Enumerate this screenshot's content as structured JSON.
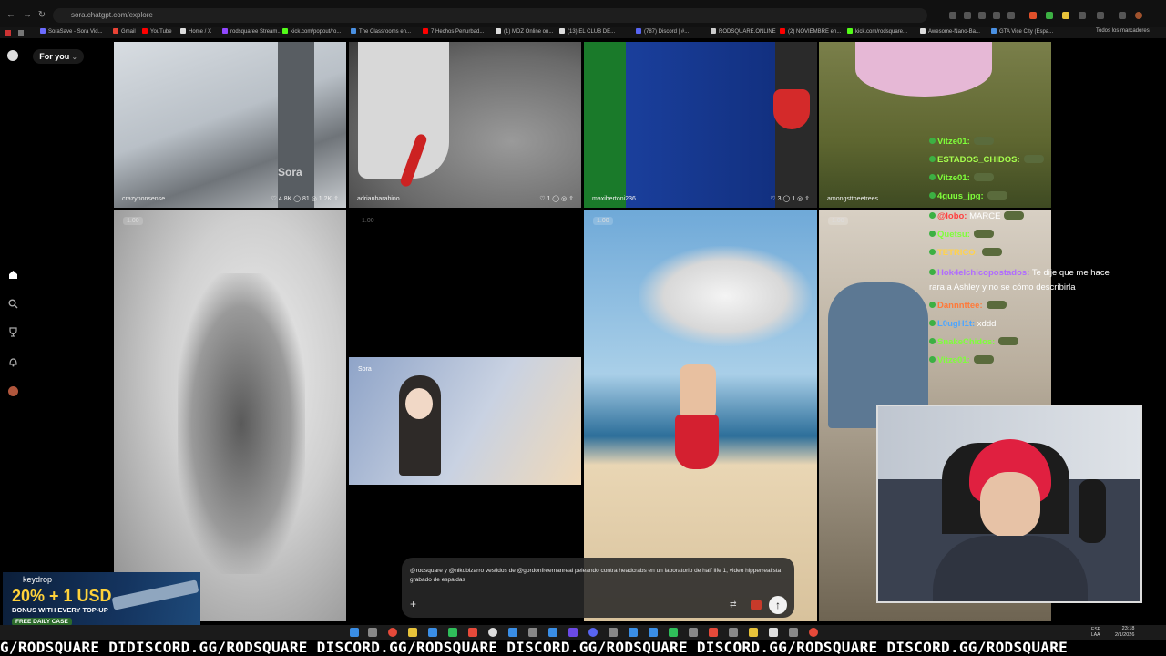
{
  "browser": {
    "url": "sora.chatgpt.com/explore",
    "bookmarks": [
      {
        "label": "SoraSave - Sora Vid...",
        "color": "#6b6bff"
      },
      {
        "label": "Gmail",
        "color": "#ea4335"
      },
      {
        "label": "YouTube",
        "color": "#ff0000"
      },
      {
        "label": "Home / X",
        "color": "#dddddd"
      },
      {
        "label": "rodsquaree Stream...",
        "color": "#9146ff"
      },
      {
        "label": "kick.com/popout/ro...",
        "color": "#53fc18"
      },
      {
        "label": "The Classrooms en...",
        "color": "#4a90e2"
      },
      {
        "label": "7 Hechos Perturbad...",
        "color": "#ff0000"
      },
      {
        "label": "(1) MDZ Online on...",
        "color": "#dddddd"
      },
      {
        "label": "(13) EL CLUB DE...",
        "color": "#dddddd"
      },
      {
        "label": "(787) Discord | #...",
        "color": "#5865f2"
      },
      {
        "label": "RODSQUARE.ONLINE",
        "color": "#cccccc"
      },
      {
        "label": "(2) NOVIEMBRE en...",
        "color": "#ff0000"
      },
      {
        "label": "kick.com/rodsquare...",
        "color": "#53fc18"
      },
      {
        "label": "Awesome-Nano-Ba...",
        "color": "#dddddd"
      },
      {
        "label": "GTA Vice City (Espa...",
        "color": "#4a90e2"
      }
    ],
    "all_bookmarks": "Todos los marcadores"
  },
  "sora": {
    "filter_label": "For you",
    "cards_top": [
      {
        "user": "crazynonsense",
        "stats": "♡ 4.8K  ◯ 81  ◎ 1.2K  ⇧",
        "watermark": "Sora"
      },
      {
        "user": "adrianbarabino",
        "stats": "♡ 1  ◯  ◎  ⇧"
      },
      {
        "user": "maxibertoni236",
        "stats": "♡ 3  ◯ 1  ◎  ⇧"
      },
      {
        "user": "amongsttheetrees",
        "stats": ""
      }
    ],
    "speed_chip": "1.00",
    "card_sora_label": "Sora",
    "prompt_text": "@rodsquare y @nikobizarro vestidos de @gordonfreemanreal peleando contra headcrabs en un laboratorio de half life 1, video hipperrealista grabado de espaldas",
    "prompt_add": "+"
  },
  "chat": [
    {
      "name": "Vitze01:",
      "color": "#7fff3a",
      "msg": "",
      "emote": true
    },
    {
      "name": "ESTADOS_CHIDOS:",
      "color": "#a6ff4d",
      "msg": "",
      "emote": true
    },
    {
      "name": "Vitze01:",
      "color": "#7fff3a",
      "msg": "",
      "emote": true
    },
    {
      "name": "4guus_jpg:",
      "color": "#7fff3a",
      "msg": "",
      "emote": true
    },
    {
      "name": "@lobo:",
      "color": "#ff4040",
      "msg": " MARCE",
      "emote": true
    },
    {
      "name": "Quetsu:",
      "color": "#7fff3a",
      "msg": "",
      "emote": true
    },
    {
      "name": "TETRICO:",
      "color": "#ffd24d",
      "msg": "",
      "emote": true
    },
    {
      "name": "Hok4elchicopostados:",
      "color": "#b06bff",
      "msg": " Te dije que me hace",
      "emote": false
    },
    {
      "name": "",
      "color": "#ffffff",
      "msg": "rara a Ashley y no se cómo describirla",
      "emote": false
    },
    {
      "name": "Dannnttee:",
      "color": "#ff7a3a",
      "msg": "",
      "emote": true
    },
    {
      "name": "L0ugH1t:",
      "color": "#4da6ff",
      "msg": " xddd",
      "emote": false
    },
    {
      "name": "SnakeChidos:",
      "color": "#7fff3a",
      "msg": "",
      "emote": true
    },
    {
      "name": "Vitze01:",
      "color": "#7fff3a",
      "msg": "",
      "emote": true
    }
  ],
  "ad": {
    "brand": "keydrop",
    "headline": "20% + 1 USD",
    "sub": "BONUS WITH EVERY TOP-UP",
    "cta": "FREE DAILY CASE"
  },
  "taskbar": {
    "lang": "ESP\nLAA",
    "time": "23:18",
    "date": "2/1/2026"
  },
  "ticker": "G/RODSQUARE DIDISCORD.GG/RODSQUARE DISCORD.GG/RODSQUARE DISCORD.GG/RODSQUARE DISCORD.GG/RODSQUARE DISCORD.GG/RODSQUARE"
}
